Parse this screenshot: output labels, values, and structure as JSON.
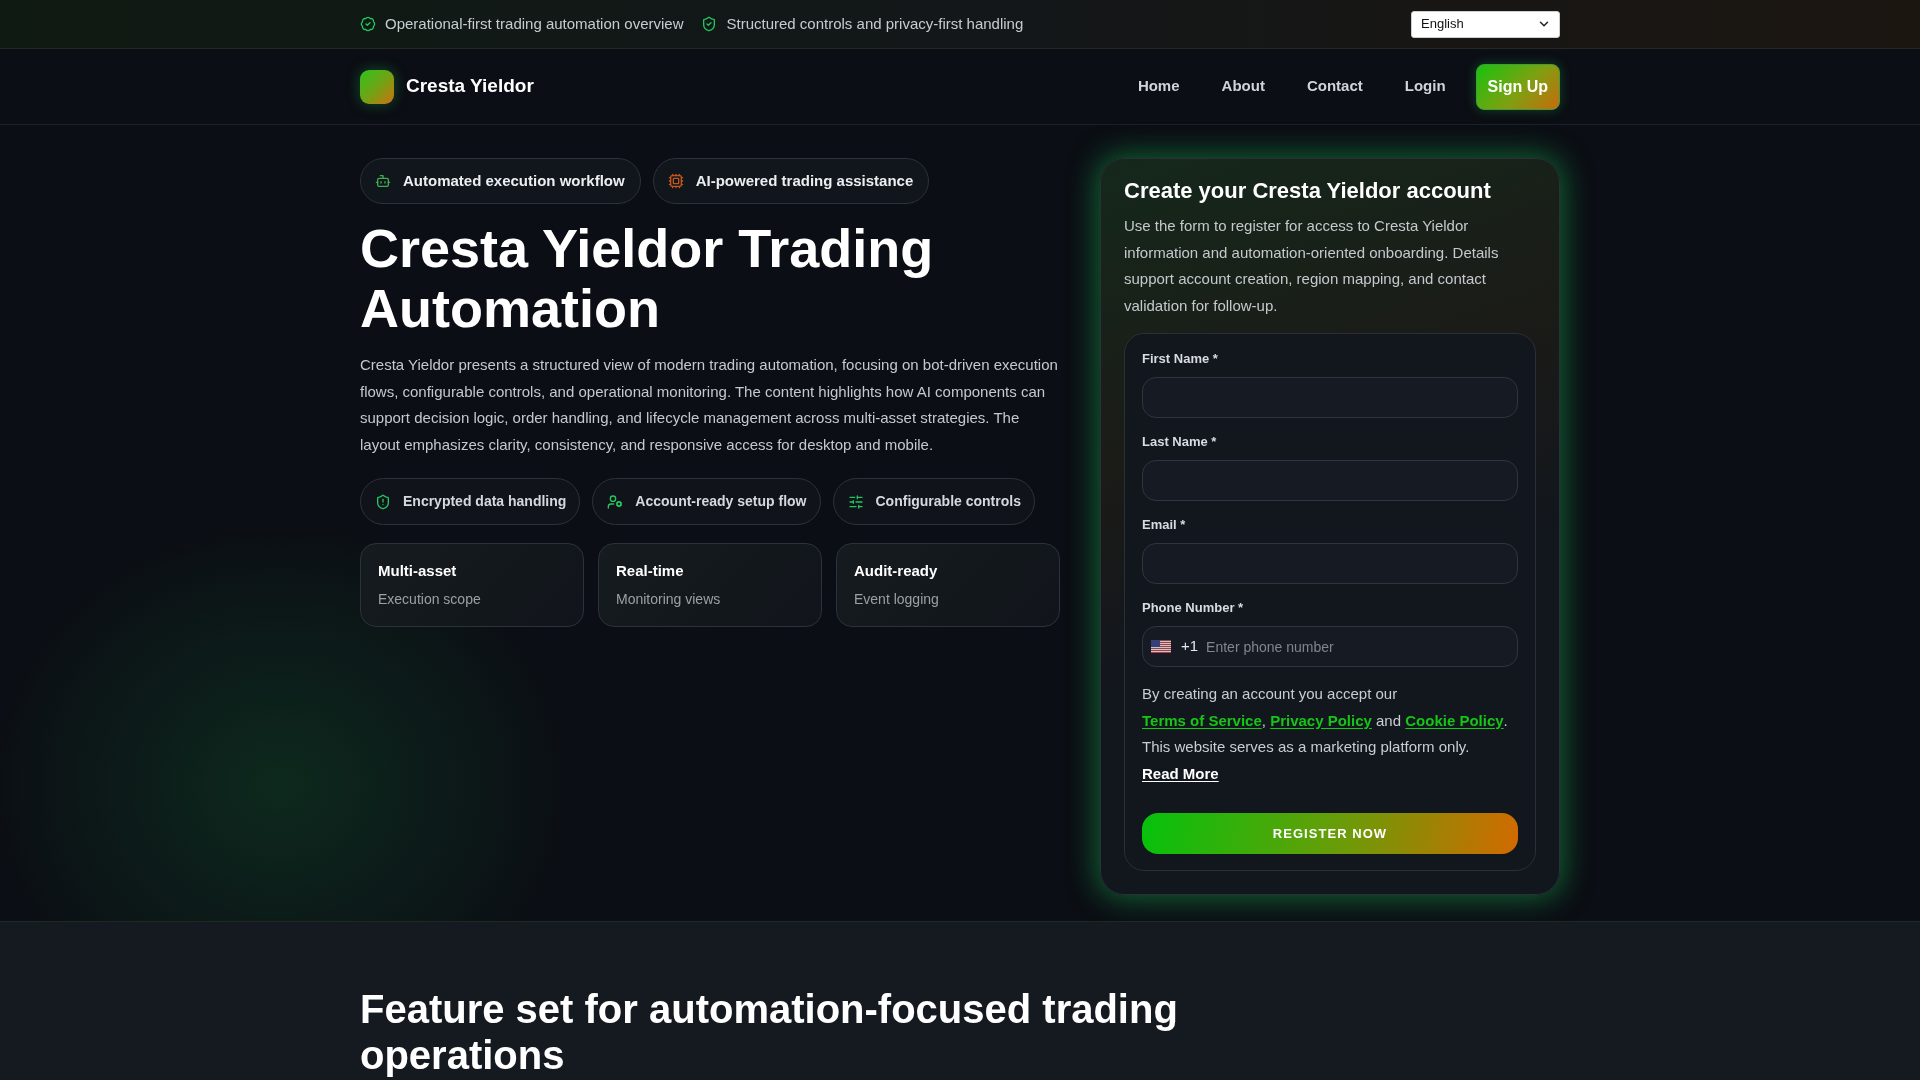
{
  "top_bar": {
    "highlights": [
      {
        "text": "Operational-first trading automation overview"
      },
      {
        "text": "Structured controls and privacy-first handling"
      }
    ],
    "language_select": {
      "value": "English"
    }
  },
  "nav": {
    "brand": "Cresta Yieldor",
    "links": [
      {
        "label": "Home"
      },
      {
        "label": "About"
      },
      {
        "label": "Contact"
      },
      {
        "label": "Login"
      }
    ],
    "cta": {
      "label": "Sign Up"
    }
  },
  "hero": {
    "badges": [
      {
        "label": "Automated execution workflow",
        "color": "#3fae4f"
      },
      {
        "label": "AI-powered trading assistance",
        "color": "#c0561a"
      }
    ],
    "title": "Cresta Yieldor Trading Automation",
    "description": "Cresta Yieldor presents a structured view of modern trading automation, focusing on bot-driven execution flows, configurable controls, and operational monitoring. The content highlights how AI components can support decision logic, order handling, and lifecycle management across multi-asset strategies. The layout emphasizes clarity, consistency, and responsive access for desktop and mobile.",
    "features": [
      {
        "label": "Encrypted data handling"
      },
      {
        "label": "Account-ready setup flow"
      },
      {
        "label": "Configurable controls"
      }
    ],
    "stats": [
      {
        "title": "Multi-asset",
        "subtitle": "Execution scope"
      },
      {
        "title": "Real-time",
        "subtitle": "Monitoring views"
      },
      {
        "title": "Audit-ready",
        "subtitle": "Event logging"
      }
    ]
  },
  "signup_form": {
    "title": "Create your Cresta Yieldor account",
    "description": "Use the form to register for access to Cresta Yieldor information and automation-oriented onboarding. Details support account creation, region mapping, and contact validation for follow-up.",
    "fields": [
      {
        "kind": "text",
        "label": "First Name *"
      },
      {
        "kind": "text",
        "label": "Last Name *"
      },
      {
        "kind": "text",
        "label": "Email *"
      },
      {
        "kind": "phone",
        "label": "Phone Number *",
        "dial_code": "+1",
        "placeholder": "Enter phone number"
      }
    ],
    "consent": [
      {
        "kind": "text",
        "text": "By creating an account you accept our "
      },
      {
        "kind": "link",
        "text": "Terms of Service"
      },
      {
        "kind": "text",
        "text": ", "
      },
      {
        "kind": "link",
        "text": "Privacy Policy"
      },
      {
        "kind": "text",
        "text": " and "
      },
      {
        "kind": "link",
        "text": "Cookie Policy"
      },
      {
        "kind": "text",
        "text": ". This website serves as a marketing platform only. "
      },
      {
        "kind": "more_link",
        "text": "Read More"
      }
    ],
    "submit": {
      "label": "REGISTER NOW"
    }
  },
  "features_section": {
    "title": "Feature set for automation-focused trading operations"
  }
}
